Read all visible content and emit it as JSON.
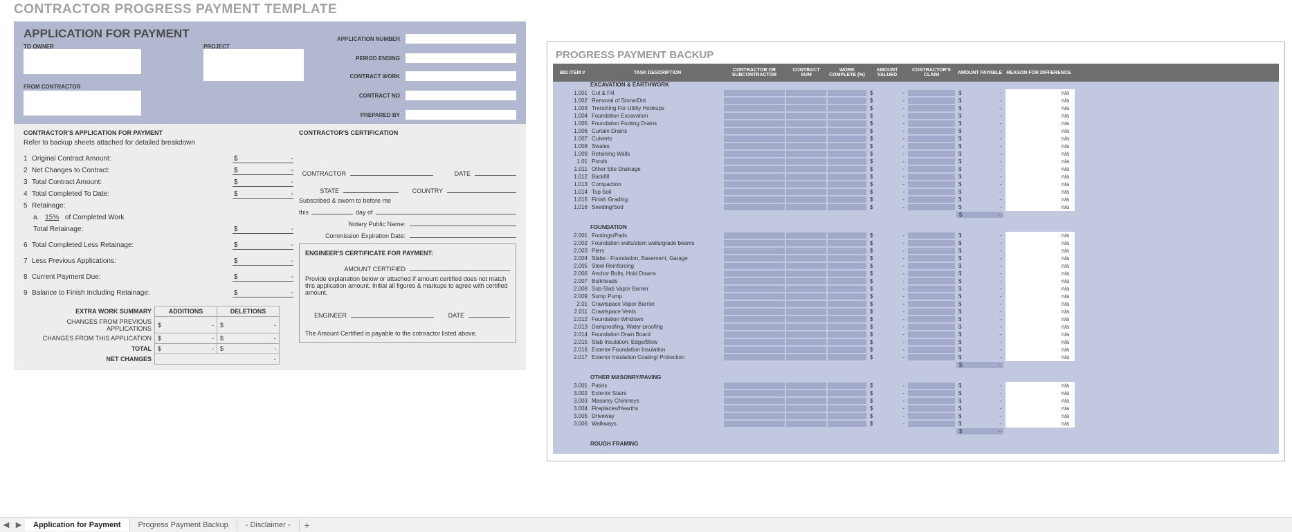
{
  "main_title": "CONTRACTOR PROGRESS PAYMENT TEMPLATE",
  "app": {
    "title": "APPLICATION FOR PAYMENT",
    "labels": {
      "to_owner": "TO OWNER",
      "from_contractor": "FROM CONTRACTOR",
      "project": "PROJECT",
      "app_no": "APPLICATION NUMBER",
      "period": "PERIOD ENDING",
      "contract_work": "CONTRACT WORK",
      "contract_no": "CONTRACT NO",
      "prepared_by": "PREPARED BY"
    }
  },
  "left_col": {
    "head": "CONTRACTOR'S APPLICATION FOR PAYMENT",
    "sub": "Refer to backup sheets attached for detailed breakdown",
    "lines": {
      "l1": "Original Contract Amount:",
      "l2": "Net Changes to Contract:",
      "l3": "Total Contract Amount:",
      "l4": "Total Completed To Date:",
      "l5": "Retainage:",
      "l5a_pre": "a.",
      "l5a_pct": "15%",
      "l5a_post": "of Completed Work",
      "l5t": "Total Retainage:",
      "l6": "Total Completed Less Retainage:",
      "l7": "Less Previous Applications:",
      "l8": "Current Payment Due:",
      "l9": "Balance to Finish Including Retainage:"
    },
    "amt_prefix": "$",
    "amt_dash": "-"
  },
  "right_col": {
    "head": "CONTRACTOR'S CERTIFICATION",
    "contractor": "CONTRACTOR",
    "date": "DATE",
    "state": "STATE",
    "country": "COUNTRY",
    "sworn": "Subscribed & sworn to before me",
    "this": "this",
    "dayof": "day of",
    "notary": "Notary Public Name:",
    "comm": "Commission Expiration Date:",
    "eng_head": "ENGINEER'S CERTIFICATE FOR PAYMENT:",
    "amt_cert": "AMOUNT CERTIFIED",
    "explain": "Provide explanation below or attached if amount certified does not match this application amount. Initial all figures & markups to agree with certified amount.",
    "engineer": "ENGINEER",
    "payable": "The Amount Certified is payable to the cotnractor listed above."
  },
  "summary": {
    "head": "EXTRA WORK SUMMARY",
    "cols": {
      "add": "ADDITIONS",
      "del": "DELETIONS"
    },
    "rows": {
      "r1": "CHANGES FROM PREVIOUS APPLICATIONS",
      "r2": "CHANGES FROM THIS APPLICATION",
      "r3": "TOTAL",
      "r4": "NET CHANGES"
    },
    "prefix": "$",
    "dash": "-"
  },
  "backup": {
    "title": "PROGRESS PAYMENT BACKUP",
    "head": {
      "c1": "BID ITEM #",
      "c2": "TASK DESCRIPTION",
      "c3": "CONTRACTOR OR SUBCONTRACTOR",
      "c4": "CONTRACT SUM",
      "c5": "WORK COMPLETE (%)",
      "c6": "AMOUNT VALUED",
      "c7": "CONTRACTOR'S CLAIM",
      "c8": "AMOUNT PAYABLE",
      "c9": "REASON FOR DIFFERENCE"
    },
    "na": "n/a",
    "dollar": "$",
    "dash": "-",
    "sections": [
      {
        "name": "EXCAVATION & EARTHWORK",
        "items": [
          {
            "id": "1.001",
            "desc": "Cut & Fill"
          },
          {
            "id": "1.002",
            "desc": "Removal of Stone/Dirt"
          },
          {
            "id": "1.003",
            "desc": "Trenching For Utility Hookups"
          },
          {
            "id": "1.004",
            "desc": "Foundation Excavation"
          },
          {
            "id": "1.005",
            "desc": "Foundation Footing Drains"
          },
          {
            "id": "1.006",
            "desc": "Curtain Drains"
          },
          {
            "id": "1.007",
            "desc": "Culverts"
          },
          {
            "id": "1.008",
            "desc": "Swales"
          },
          {
            "id": "1.009",
            "desc": "Retaining Walls"
          },
          {
            "id": "1.01",
            "desc": "Ponds"
          },
          {
            "id": "1.011",
            "desc": "Other Site Drainage"
          },
          {
            "id": "1.012",
            "desc": "Backfill"
          },
          {
            "id": "1.013",
            "desc": "Compaction"
          },
          {
            "id": "1.014",
            "desc": "Top Soil"
          },
          {
            "id": "1.015",
            "desc": "Finish Grading"
          },
          {
            "id": "1.016",
            "desc": "Seeding/Sod"
          }
        ]
      },
      {
        "name": "FOUNDATION",
        "items": [
          {
            "id": "2.001",
            "desc": "Footings/Pads"
          },
          {
            "id": "2.002",
            "desc": "Foundation walls/stem walls/grade beams"
          },
          {
            "id": "2.003",
            "desc": "Piers"
          },
          {
            "id": "2.004",
            "desc": "Slabs - Foundation, Basement, Garage"
          },
          {
            "id": "2.005",
            "desc": "Steel Reinforcing"
          },
          {
            "id": "2.006",
            "desc": "Anchor Bolts, Hold Downs"
          },
          {
            "id": "2.007",
            "desc": "Bulkheads"
          },
          {
            "id": "2.008",
            "desc": "Sub-Slab Vapor Barrier"
          },
          {
            "id": "2.009",
            "desc": "Sump Pump"
          },
          {
            "id": "2.01",
            "desc": "Crawlspace Vapor Barrier"
          },
          {
            "id": "2.011",
            "desc": "Crawlspace Vents"
          },
          {
            "id": "2.012",
            "desc": "Foundation Windows"
          },
          {
            "id": "2.013",
            "desc": "Damproofing, Water-proofing"
          },
          {
            "id": "2.014",
            "desc": "Foundation Drain Board"
          },
          {
            "id": "2.015",
            "desc": "Slab Insulation: Edge/Blow"
          },
          {
            "id": "2.016",
            "desc": "Exterior Foundation Insulation"
          },
          {
            "id": "2.017",
            "desc": "Exterior Insulation Coating/ Protection"
          }
        ]
      },
      {
        "name": "OTHER MASONRY/PAVING",
        "items": [
          {
            "id": "3.001",
            "desc": "Patios"
          },
          {
            "id": "3.002",
            "desc": "Exterior Stairs"
          },
          {
            "id": "3.003",
            "desc": "Masonry Chimneys"
          },
          {
            "id": "3.004",
            "desc": "Fireplaces/Hearths"
          },
          {
            "id": "3.005",
            "desc": "Driveway"
          },
          {
            "id": "3.006",
            "desc": "Walkways"
          }
        ]
      },
      {
        "name": "ROUGH FRAMING",
        "items": []
      }
    ]
  },
  "tabs": {
    "t1": "Application for Payment",
    "t2": "Progress Payment Backup",
    "t3": "- Disclaimer -"
  }
}
